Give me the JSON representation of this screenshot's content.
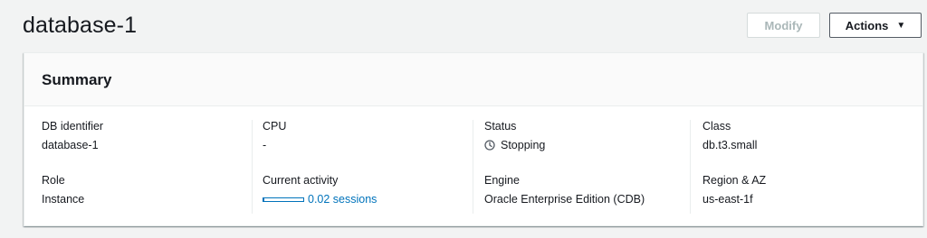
{
  "page": {
    "title": "database-1"
  },
  "toolbar": {
    "modify_label": "Modify",
    "actions_label": "Actions"
  },
  "summary": {
    "title": "Summary",
    "db_identifier": {
      "label": "DB identifier",
      "value": "database-1"
    },
    "cpu": {
      "label": "CPU",
      "value": "-"
    },
    "status": {
      "label": "Status",
      "value": "Stopping",
      "icon": "clock-icon"
    },
    "class": {
      "label": "Class",
      "value": "db.t3.small"
    },
    "role": {
      "label": "Role",
      "value": "Instance"
    },
    "current_activity": {
      "label": "Current activity",
      "value": "0.02 sessions",
      "bar_fraction": 0.02
    },
    "engine": {
      "label": "Engine",
      "value": "Oracle Enterprise Edition (CDB)"
    },
    "region_az": {
      "label": "Region & AZ",
      "value": "us-east-1f"
    }
  },
  "colors": {
    "background": "#f2f3f3",
    "link": "#0073bb",
    "text": "#16191f",
    "disabled_text": "#aab7b8"
  }
}
